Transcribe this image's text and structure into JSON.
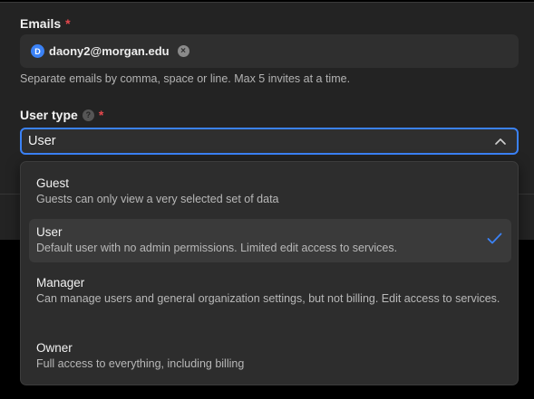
{
  "emails": {
    "label": "Emails",
    "required_mark": "*",
    "chip": {
      "avatar_letter": "D",
      "email": "daony2@morgan.edu",
      "remove_glyph": "×"
    },
    "hint": "Separate emails by comma, space or line. Max 5 invites at a time."
  },
  "user_type": {
    "label": "User type",
    "help_glyph": "?",
    "required_mark": "*",
    "selected_value": "User",
    "options": [
      {
        "title": "Guest",
        "description": "Guests can only view a very selected set of data",
        "selected": false
      },
      {
        "title": "User",
        "description": "Default user with no admin permissions. Limited edit access to services.",
        "selected": true
      },
      {
        "title": "Manager",
        "description": "Can manage users and general organization settings, but not billing. Edit access to services.",
        "selected": false
      },
      {
        "title": "Owner",
        "description": "Full access to everything, including billing",
        "selected": false
      }
    ]
  },
  "icons": {
    "chevron": "chevron-up-icon",
    "check": "check-icon",
    "help": "help-icon",
    "remove": "close-icon"
  },
  "colors": {
    "accent": "#3b82f6",
    "required": "#e5484d",
    "panel_bg": "#232323",
    "field_bg": "#2f2f2f",
    "dropdown_bg": "#2d2d2d"
  }
}
